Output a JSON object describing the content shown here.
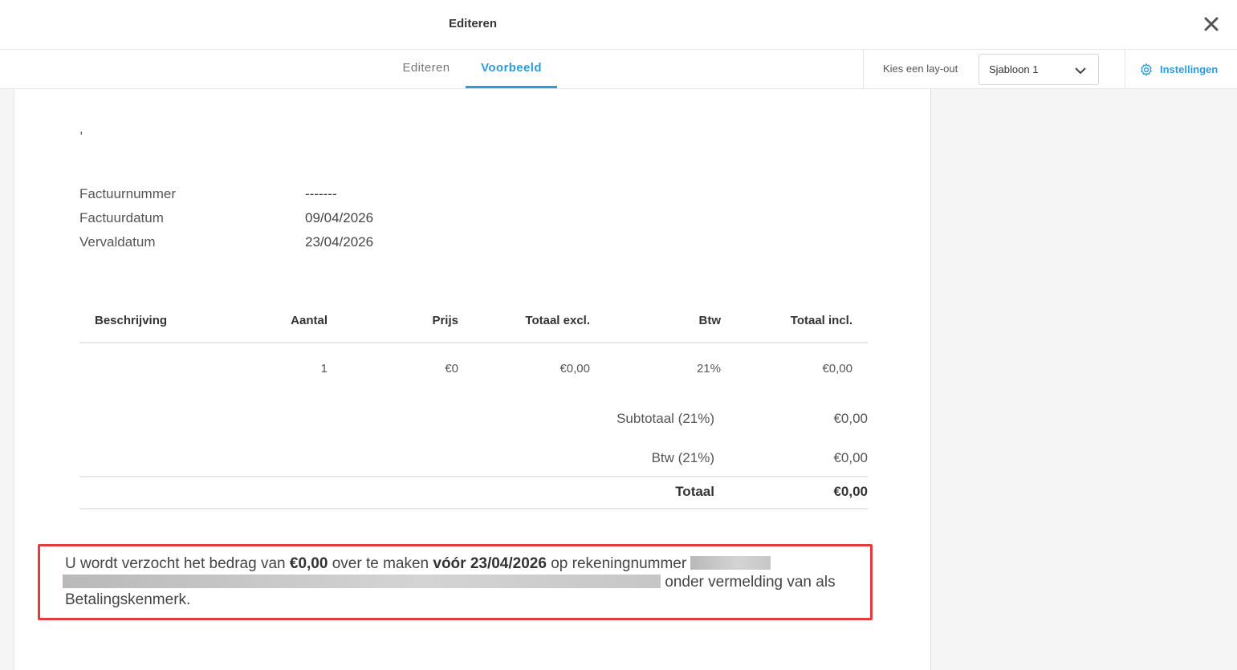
{
  "header": {
    "title": "Editeren"
  },
  "tabs": {
    "edit_label": "Editeren",
    "preview_label": "Voorbeeld"
  },
  "layout": {
    "label": "Kies een lay-out",
    "selected": "Sjabloon 1"
  },
  "settings": {
    "label": "Instellingen"
  },
  "invoice": {
    "recipient_line": ",",
    "meta": {
      "number_label": "Factuurnummer",
      "number_value": "-------",
      "date_label": "Factuurdatum",
      "date_value": "09/04/2026",
      "due_label": "Vervaldatum",
      "due_value": "23/04/2026"
    },
    "table": {
      "headers": [
        "Beschrijving",
        "Aantal",
        "Prijs",
        "Totaal excl.",
        "Btw",
        "Totaal incl."
      ],
      "rows": [
        [
          "",
          "1",
          "€0",
          "€0,00",
          "21%",
          "€0,00"
        ]
      ]
    },
    "totals": {
      "subtotal_label": "Subtotaal (21%)",
      "subtotal_value": "€0,00",
      "vat_label": "Btw (21%)",
      "vat_value": "€0,00",
      "total_label": "Totaal",
      "total_value": "€0,00"
    },
    "payment_note": {
      "part1": "U wordt verzocht het bedrag van ",
      "amount": "€0,00",
      "part2": " over te maken ",
      "due": "vóór 23/04/2026",
      "part3": " op rekeningnummer ",
      "part4": " onder vermelding van  als Betalingskenmerk."
    }
  },
  "colors": {
    "accent": "#2d9cdb",
    "highlight_border": "#e23b3b"
  }
}
